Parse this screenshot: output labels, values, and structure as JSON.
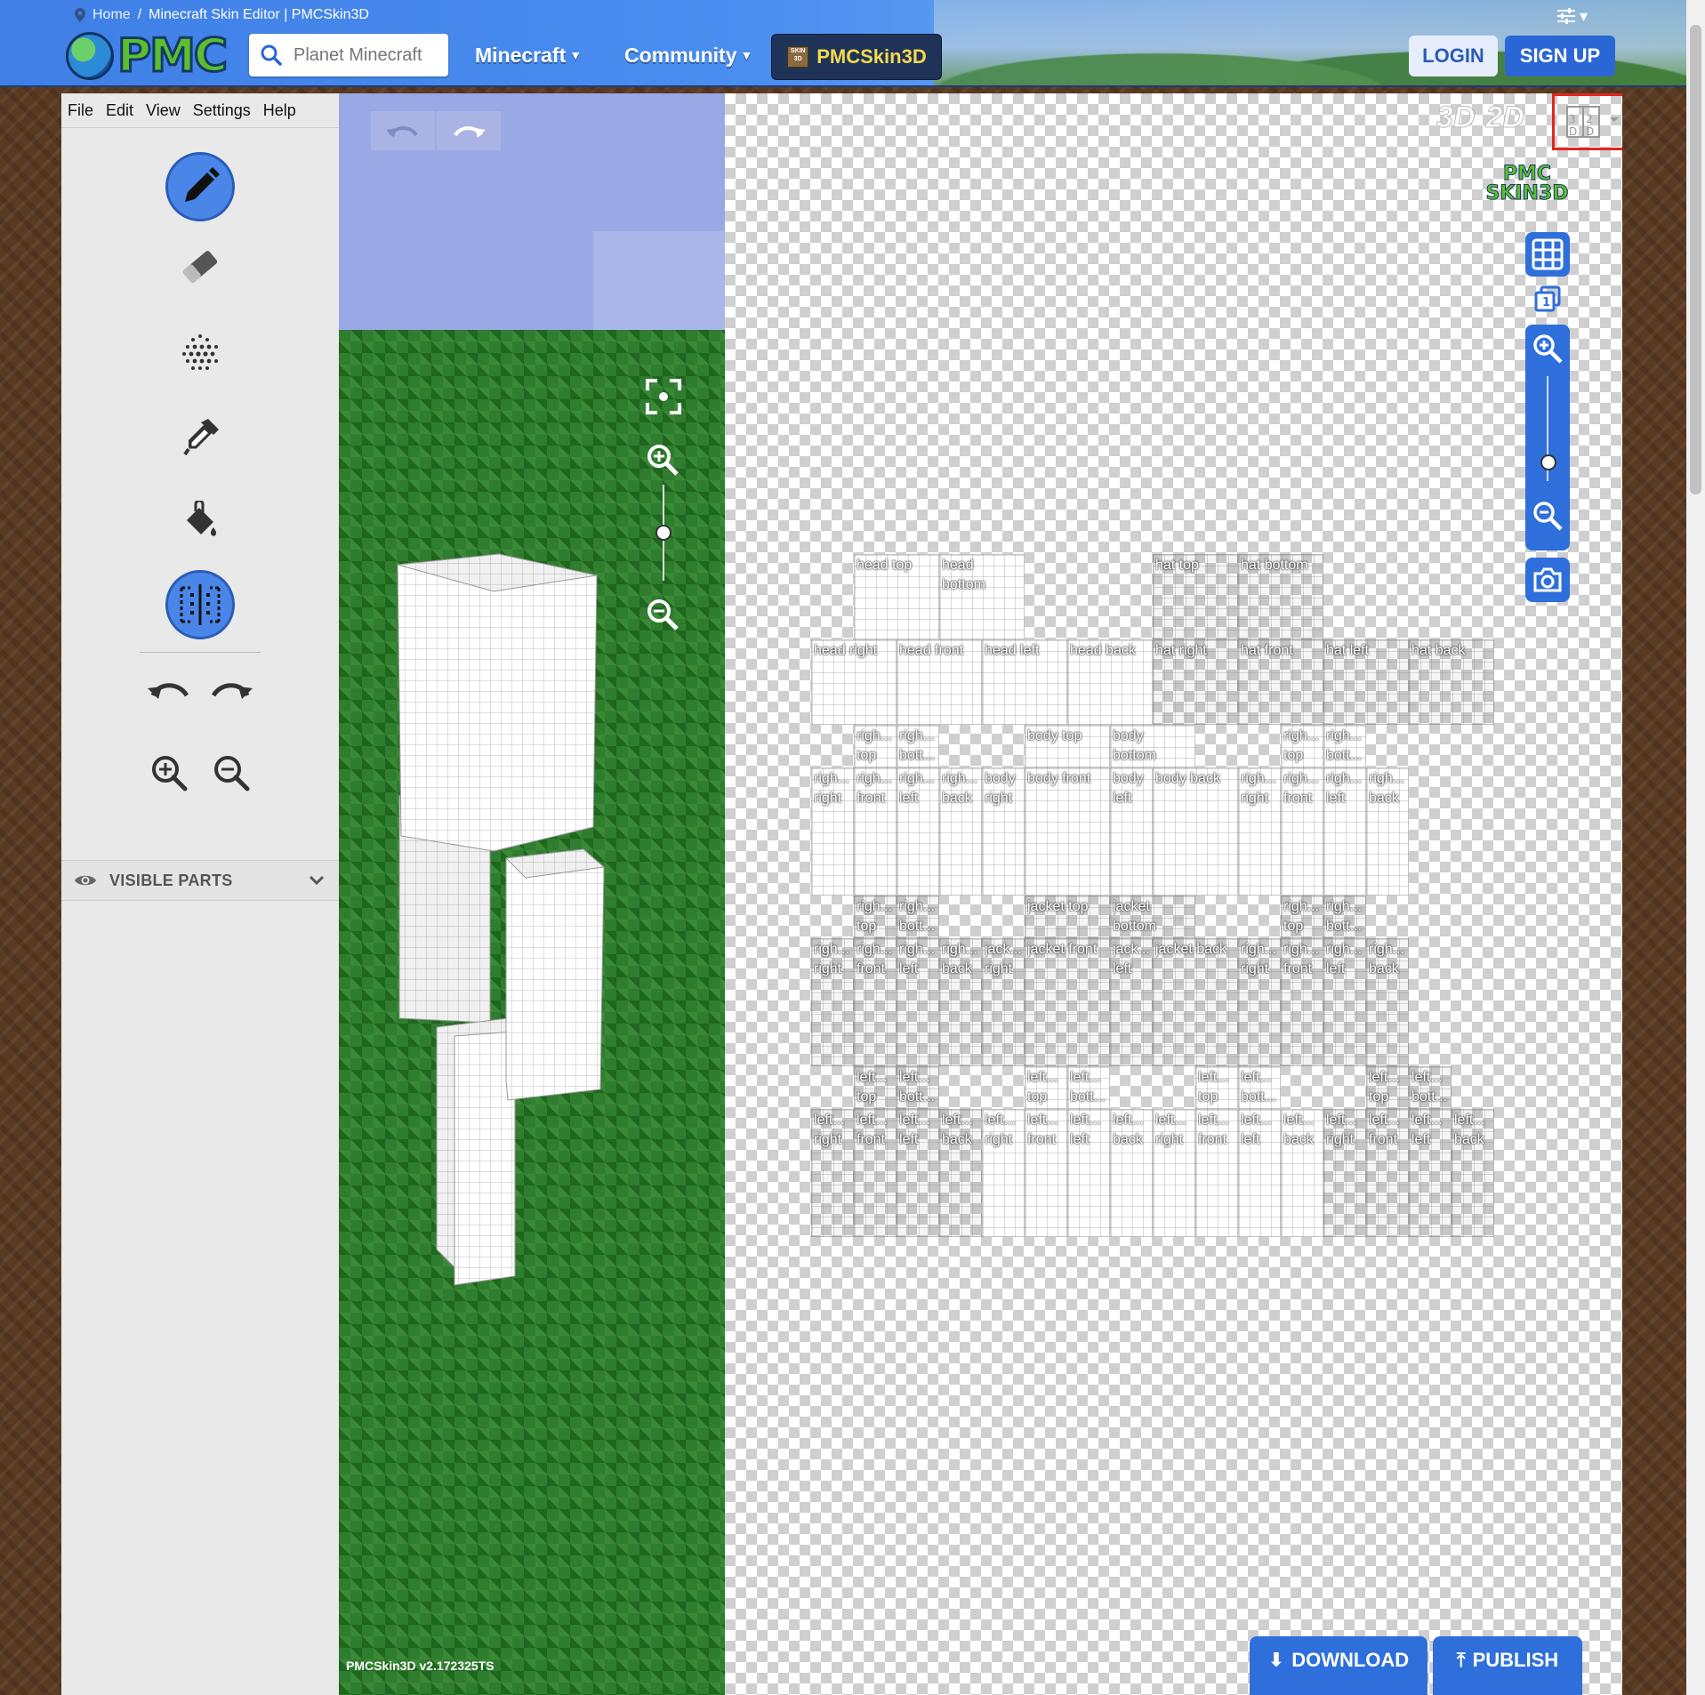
{
  "header": {
    "breadcrumb": {
      "home": "Home",
      "separator": "/",
      "current": "Minecraft Skin Editor | PMCSkin3D"
    },
    "logo_text": "PMC",
    "search_placeholder": "Planet Minecraft",
    "nav": [
      {
        "label": "Minecraft"
      },
      {
        "label": "Community"
      }
    ],
    "active_nav": "PMCSkin3D",
    "login_label": "LOGIN",
    "signup_label": "SIGN UP",
    "colors": {
      "accent": "#2a66d6",
      "gold": "#f4d94c"
    }
  },
  "editor": {
    "menu": [
      "File",
      "Edit",
      "View",
      "Settings",
      "Help"
    ],
    "tools": [
      {
        "name": "pencil",
        "active": true
      },
      {
        "name": "eraser",
        "active": false
      },
      {
        "name": "noise",
        "active": false
      },
      {
        "name": "color-picker",
        "active": false
      },
      {
        "name": "bucket",
        "active": false
      },
      {
        "name": "mirror",
        "active": true
      }
    ],
    "visible_parts_label": "VISIBLE PARTS",
    "version": "PMCSkin3D v2.172325TS",
    "mode_3d": "3D",
    "mode_2d": "2D",
    "mode_split": "3D 2D",
    "logo_badge": "PMC SKIN3D",
    "download_label": "DOWNLOAD",
    "publish_label": "PUBLISH"
  },
  "template_faces": [
    {
      "label": "head top",
      "fill": "white"
    },
    {
      "label": "head\nbottom",
      "fill": "white"
    },
    {
      "label": "hat top",
      "fill": "trans"
    },
    {
      "label": "hat bottom",
      "fill": "trans"
    },
    {
      "label": "head right",
      "fill": "white"
    },
    {
      "label": "head front",
      "fill": "white"
    },
    {
      "label": "head left",
      "fill": "white"
    },
    {
      "label": "head back",
      "fill": "white"
    },
    {
      "label": "hat right",
      "fill": "trans"
    },
    {
      "label": "hat front",
      "fill": "trans"
    },
    {
      "label": "hat left",
      "fill": "trans"
    },
    {
      "label": "hat back",
      "fill": "trans"
    },
    {
      "label": "righ...\ntop",
      "fill": "white"
    },
    {
      "label": "righ...\nbott...",
      "fill": "white"
    },
    {
      "label": "body top",
      "fill": "white"
    },
    {
      "label": "body\nbottom",
      "fill": "white"
    },
    {
      "label": "righ...\ntop",
      "fill": "white"
    },
    {
      "label": "righ...\nbott...",
      "fill": "white"
    },
    {
      "label": "righ...\nright",
      "fill": "white"
    },
    {
      "label": "righ...\nfront",
      "fill": "white"
    },
    {
      "label": "righ...\nleft",
      "fill": "white"
    },
    {
      "label": "righ...\nback",
      "fill": "white"
    },
    {
      "label": "body\nright",
      "fill": "white"
    },
    {
      "label": "body front",
      "fill": "white"
    },
    {
      "label": "body\nleft",
      "fill": "white"
    },
    {
      "label": "body back",
      "fill": "white"
    },
    {
      "label": "righ...\nright",
      "fill": "white"
    },
    {
      "label": "righ...\nfront",
      "fill": "white"
    },
    {
      "label": "righ...\nleft",
      "fill": "white"
    },
    {
      "label": "righ...\nback",
      "fill": "white"
    },
    {
      "label": "righ...\ntop",
      "fill": "trans"
    },
    {
      "label": "righ...\nbott...",
      "fill": "trans"
    },
    {
      "label": "jacket top",
      "fill": "trans"
    },
    {
      "label": "jacket\nbottom",
      "fill": "trans"
    },
    {
      "label": "righ...\ntop",
      "fill": "trans"
    },
    {
      "label": "righ...\nbott...",
      "fill": "trans"
    },
    {
      "label": "righ...\nright",
      "fill": "trans"
    },
    {
      "label": "righ...\nfront",
      "fill": "trans"
    },
    {
      "label": "righ...\nleft",
      "fill": "trans"
    },
    {
      "label": "righ...\nback",
      "fill": "trans"
    },
    {
      "label": "jack...\nright",
      "fill": "trans"
    },
    {
      "label": "jacket front",
      "fill": "trans"
    },
    {
      "label": "jack...\nleft",
      "fill": "trans"
    },
    {
      "label": "jacket back",
      "fill": "trans"
    },
    {
      "label": "righ...\nright",
      "fill": "trans"
    },
    {
      "label": "righ...\nfront",
      "fill": "trans"
    },
    {
      "label": "righ...\nleft",
      "fill": "trans"
    },
    {
      "label": "righ...\nback",
      "fill": "trans"
    },
    {
      "label": "left...\ntop",
      "fill": "trans"
    },
    {
      "label": "left...\nbott...",
      "fill": "trans"
    },
    {
      "label": "left...\ntop",
      "fill": "white"
    },
    {
      "label": "left...\nbott...",
      "fill": "white"
    },
    {
      "label": "left...\ntop",
      "fill": "white"
    },
    {
      "label": "left...\nbott...",
      "fill": "white"
    },
    {
      "label": "left...\ntop",
      "fill": "trans"
    },
    {
      "label": "left...\nbott...",
      "fill": "trans"
    },
    {
      "label": "left...\nright",
      "fill": "trans"
    },
    {
      "label": "left...\nfront",
      "fill": "trans"
    },
    {
      "label": "left...\nleft",
      "fill": "trans"
    },
    {
      "label": "left...\nback",
      "fill": "trans"
    },
    {
      "label": "left...\nright",
      "fill": "white"
    },
    {
      "label": "left...\nfront",
      "fill": "white"
    },
    {
      "label": "left...\nleft",
      "fill": "white"
    },
    {
      "label": "left...\nback",
      "fill": "white"
    },
    {
      "label": "left...\nright",
      "fill": "white"
    },
    {
      "label": "left...\nfront",
      "fill": "white"
    },
    {
      "label": "left...\nleft",
      "fill": "white"
    },
    {
      "label": "left...\nback",
      "fill": "white"
    },
    {
      "label": "left...\nright",
      "fill": "trans"
    },
    {
      "label": "left...\nfront",
      "fill": "trans"
    },
    {
      "label": "left...\nleft",
      "fill": "trans"
    },
    {
      "label": "left...\nback",
      "fill": "trans"
    }
  ]
}
